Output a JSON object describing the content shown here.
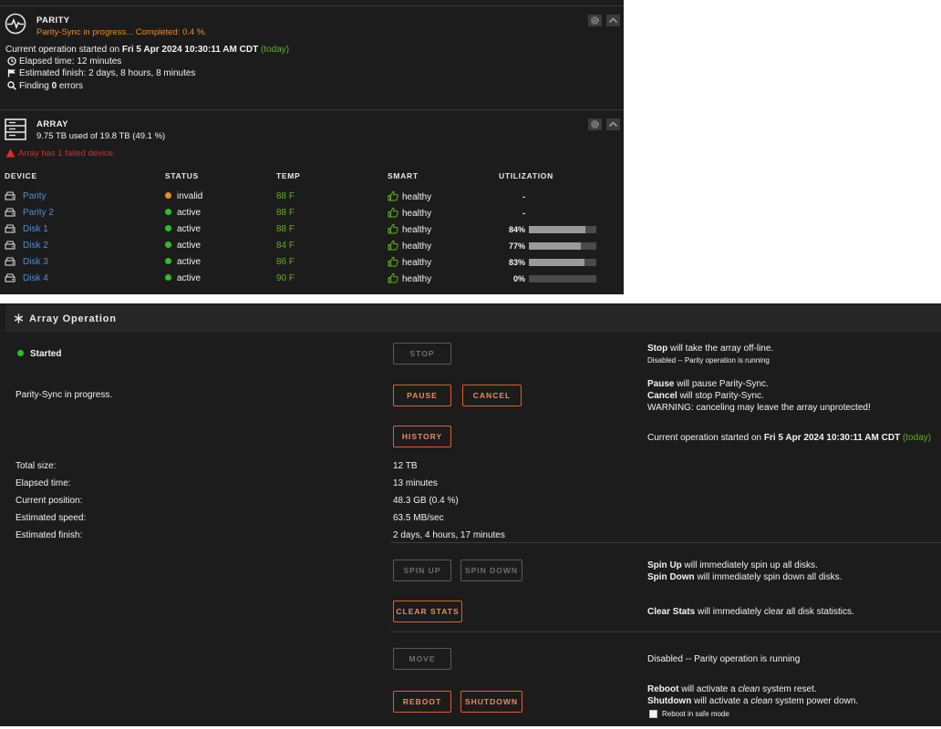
{
  "colors": {
    "panel_bg": "#1c1c1c",
    "orange": "#ee8c1f",
    "green": "#5fae26",
    "red": "#e22828",
    "link_blue": "#4d91d2",
    "button_border": "#e85b2a"
  },
  "parity": {
    "title": "PARITY",
    "progress_text": "Parity-Sync in progress... Completed: 0.4 %.",
    "op_prefix": "Current operation started on ",
    "op_date": "Fri 5 Apr 2024 10:30:11 AM CDT",
    "op_today": "(today)",
    "elapsed": "Elapsed time: 12 minutes",
    "finish": "Estimated finish: 2 days, 8 hours, 8 minutes",
    "finding_prefix": "Finding ",
    "finding_count": "0",
    "finding_suffix": " errors"
  },
  "array": {
    "title": "ARRAY",
    "usage": "9.75 TB used of 19.8 TB (49.1 %)",
    "warning": "Array has 1 failed device.",
    "columns": [
      "DEVICE",
      "STATUS",
      "TEMP",
      "SMART",
      "UTILIZATION"
    ],
    "devices": [
      {
        "name": "Parity",
        "status": "invalid",
        "status_color": "#ee8c1f",
        "temp": "88 F",
        "smart": "healthy",
        "util": "-",
        "util_value": null
      },
      {
        "name": "Parity 2",
        "status": "active",
        "status_color": "#27c227",
        "temp": "88 F",
        "smart": "healthy",
        "util": "-",
        "util_value": null
      },
      {
        "name": "Disk 1",
        "status": "active",
        "status_color": "#27c227",
        "temp": "88 F",
        "smart": "healthy",
        "util": "84%",
        "util_value": 0.84
      },
      {
        "name": "Disk 2",
        "status": "active",
        "status_color": "#27c227",
        "temp": "84 F",
        "smart": "healthy",
        "util": "77%",
        "util_value": 0.77
      },
      {
        "name": "Disk 3",
        "status": "active",
        "status_color": "#27c227",
        "temp": "86 F",
        "smart": "healthy",
        "util": "83%",
        "util_value": 0.83
      },
      {
        "name": "Disk 4",
        "status": "active",
        "status_color": "#27c227",
        "temp": "90 F",
        "smart": "healthy",
        "util": "0%",
        "util_value": 0.0
      }
    ]
  },
  "operation": {
    "title": "Array Operation",
    "state": "Started",
    "sync_status": "Parity-Sync in progress.",
    "buttons": {
      "stop": "STOP",
      "pause": "PAUSE",
      "cancel": "CANCEL",
      "history": "HISTORY",
      "spin_up": "SPIN UP",
      "spin_down": "SPIN DOWN",
      "clear_stats": "CLEAR STATS",
      "move": "MOVE",
      "reboot": "REBOOT",
      "shutdown": "SHUTDOWN"
    },
    "desc": {
      "stop_bold": "Stop",
      "stop_rest": " will take the array off-line.",
      "stop_note": "Disabled -- Parity operation is running",
      "pause_bold": "Pause",
      "pause_rest": " will pause Parity-Sync.",
      "cancel_bold": "Cancel",
      "cancel_rest": " will stop Parity-Sync.",
      "cancel_warning": "WARNING: canceling may leave the array unprotected!",
      "op_prefix": "Current operation started on ",
      "op_date": "Fri 5 Apr 2024 10:30:11 AM CDT",
      "op_today": "(today)",
      "spinup_bold": "Spin Up",
      "spinup_rest": " will immediately spin up all disks.",
      "spindown_bold": "Spin Down",
      "spindown_rest": " will immediately spin down all disks.",
      "clear_bold": "Clear Stats",
      "clear_rest": " will immediately clear all disk statistics.",
      "move_note": "Disabled -- Parity operation is running",
      "reboot_bold": "Reboot",
      "reboot_mid": " will activate a ",
      "reboot_em": "clean",
      "reboot_end": " system reset.",
      "shutdown_bold": "Shutdown",
      "shutdown_mid": " will activate a ",
      "shutdown_em": "clean",
      "shutdown_end": " system power down.",
      "safe_mode": "Reboot in safe mode"
    },
    "stats": [
      {
        "label": "Total size:",
        "value": "12 TB"
      },
      {
        "label": "Elapsed time:",
        "value": "13 minutes"
      },
      {
        "label": "Current position:",
        "value": "48.3 GB (0.4 %)"
      },
      {
        "label": "Estimated speed:",
        "value": "63.5 MB/sec"
      },
      {
        "label": "Estimated finish:",
        "value": "2 days, 4 hours, 17 minutes"
      }
    ]
  }
}
